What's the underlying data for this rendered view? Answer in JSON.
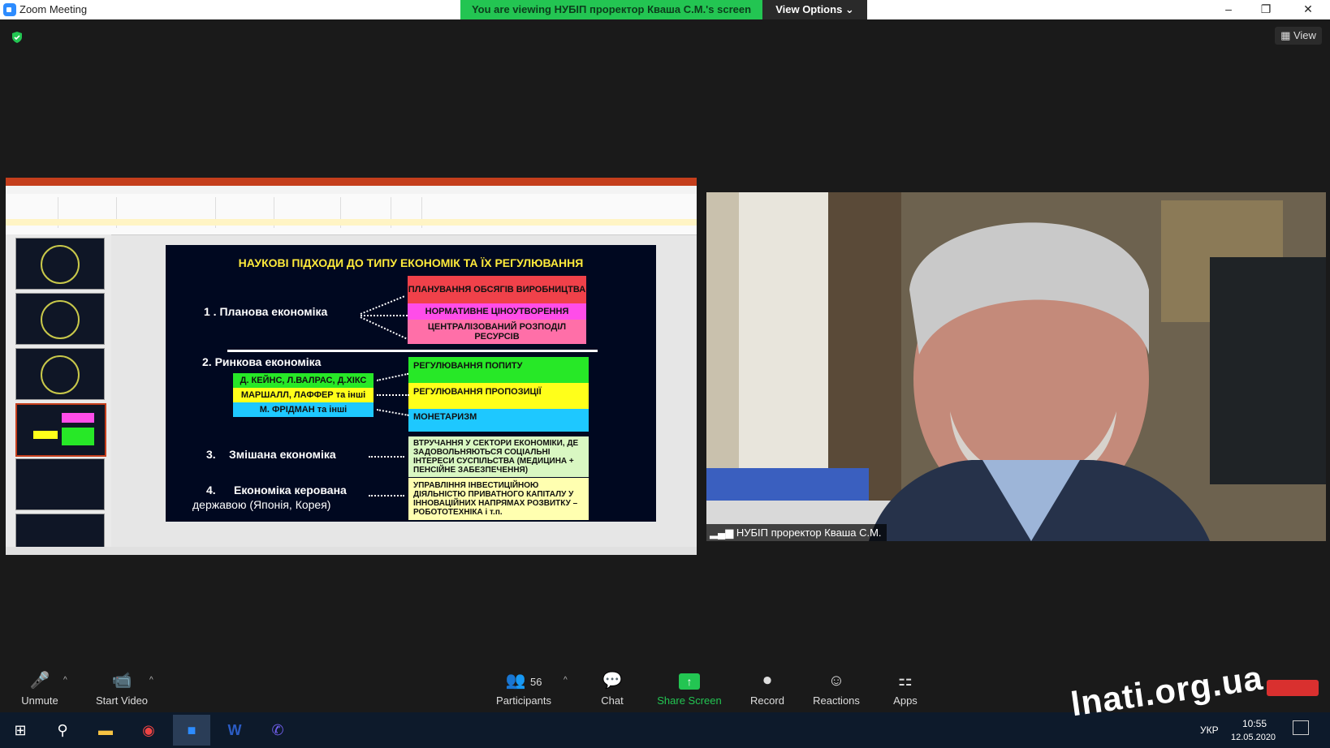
{
  "window": {
    "title": "Zoom Meeting",
    "minimize": "–",
    "restore": "❐",
    "close": "✕"
  },
  "banner": {
    "text": "You are viewing НУБІП проректор Кваша С.М.'s screen",
    "view_options": "View Options ⌄"
  },
  "top_right": {
    "view_label": "View"
  },
  "slide": {
    "title": "НАУКОВІ ПІДХОДИ ДО ТИПУ ЕКОНОМІК ТА ЇХ РЕГУЛЮВАННЯ",
    "item1": "1 . Планова економіка",
    "item2": "2. Ринкова економіка",
    "item3_num": "3.",
    "item3": "Змішана економіка",
    "item4_num": "4.",
    "item4_line1": "Економіка керована",
    "item4_line2": "державою (Японія, Корея)",
    "planned": [
      "ПЛАНУВАННЯ ОБСЯГІВ ВИРОБНИЦТВА",
      "НОРМАТИВНЕ ЦІНОУТВОРЕННЯ",
      "ЦЕНТРАЛІЗОВАНИЙ РОЗПОДІЛ РЕСУРСІВ"
    ],
    "economists": [
      "Д. КЕЙНС, Л.ВАЛРАС, Д.ХІКС",
      "МАРШАЛЛ, ЛАФФЕР та інші",
      "М. ФРІДМАН та інші"
    ],
    "market": [
      "РЕГУЛЮВАННЯ ПОПИТУ",
      "РЕГУЛЮВАННЯ ПРОПОЗИЦІЇ",
      "МОНЕТАРИЗМ"
    ],
    "mixed": "ВТРУЧАННЯ У СЕКТОРИ ЕКОНОМІКИ, ДЕ ЗАДОВОЛЬНЯЮТЬСЯ СОЦІАЛЬНІ ІНТЕРЕСИ СУСПІЛЬСТВА (МЕДИЦИНА + ПЕНСІЙНЕ ЗАБЕЗПЕЧЕННЯ)",
    "state": "УПРАВЛІННЯ ІНВЕСТИЦІЙНОЮ ДІЯЛЬНІСТЮ ПРИВАТНОГО КАПІТАЛУ У ІННОВАЦІЙНИХ НАПРЯМАХ РОЗВИТКУ – РОБОТОТЕХНІКА і т.п."
  },
  "colors": {
    "banner": "#23c552",
    "red": "#f0414a",
    "magenta": "#ff4de9",
    "pink": "#ff6fa8",
    "green": "#27e827",
    "yellow": "#ffff1a",
    "cyan": "#1ec8ff",
    "lightgreen": "#d9f7c2",
    "lightyellow": "#ffffb0"
  },
  "video": {
    "name": "НУБІП проректор Кваша С.М."
  },
  "toolbar": {
    "unmute": "Unmute",
    "start_video": "Start Video",
    "participants": "Participants",
    "participants_count": "56",
    "chat": "Chat",
    "share_screen": "Share Screen",
    "record": "Record",
    "reactions": "Reactions",
    "apps": "Apps"
  },
  "taskbar": {
    "lang": "УКР",
    "time": "10:55",
    "date": "12.05.2020"
  },
  "watermark": "lnati.org.ua"
}
